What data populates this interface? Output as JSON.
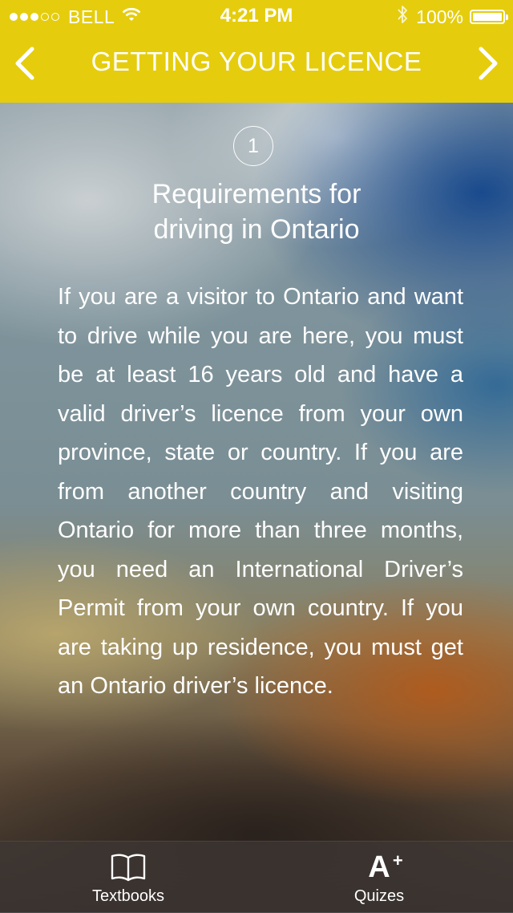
{
  "status_bar": {
    "signal_dots_full": 3,
    "signal_dots_empty": 2,
    "carrier": "BELL",
    "time": "4:21 PM",
    "battery_percent": "100%",
    "icons": [
      "wifi-icon",
      "bluetooth-icon",
      "battery-icon"
    ]
  },
  "nav": {
    "title": "GETTING YOUR LICENCE",
    "back_icon": "chevron-left-icon",
    "forward_icon": "chevron-right-icon"
  },
  "section": {
    "step_number": "1",
    "title_line1": "Requirements for",
    "title_line2": "driving in Ontario",
    "body": "If you are a visitor to  Ontario and want to drive while you are here, you must be at least 16 years old and have a valid driver’s licence from your own province, state or country. If you are from another country and visiting Ontario for more than three months, you need an International Driver’s Permit from your own country. If you are taking up residence, you must get an Ontario driver’s licence."
  },
  "tabs": [
    {
      "label": "Textbooks",
      "icon": "book-icon"
    },
    {
      "label": "Quizes",
      "icon": "a-plus-icon",
      "icon_text": "A",
      "icon_sup": "+"
    }
  ],
  "colors": {
    "nav_bar": "#e5cd0e",
    "text": "#ffffff"
  }
}
